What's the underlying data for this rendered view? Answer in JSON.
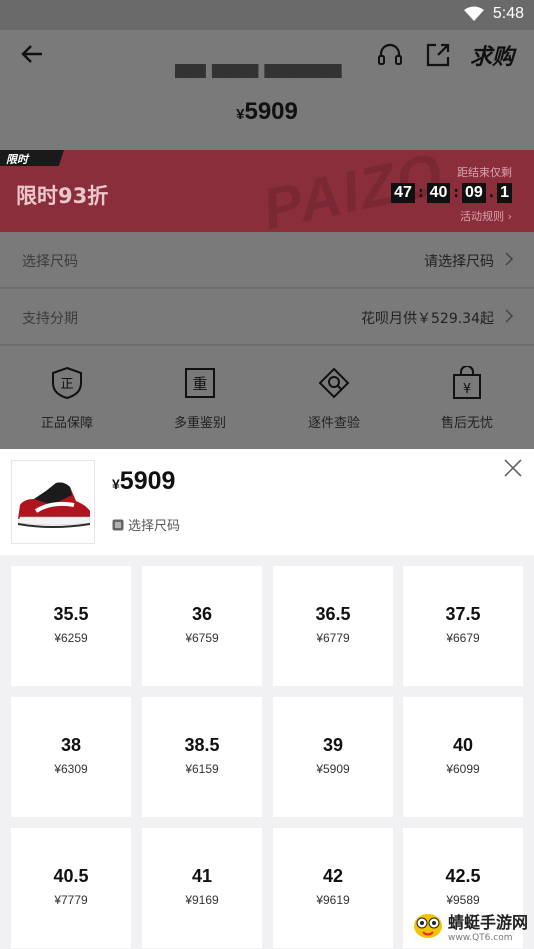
{
  "status_bar": {
    "time": "5:48"
  },
  "header": {
    "request_label": "求购"
  },
  "product": {
    "price_symbol": "¥",
    "price": "5909"
  },
  "promo": {
    "tag": "限时",
    "title": "限时93折",
    "countdown_label": "距结束仅剩",
    "countdown": [
      "47",
      "40",
      "09",
      "1"
    ],
    "rules": "活动规则",
    "watermark": "PAIZO"
  },
  "rows": [
    {
      "label": "选择尺码",
      "value": "请选择尺码"
    },
    {
      "label": "支持分期",
      "value": "花呗月供￥529.34起"
    }
  ],
  "assurances": [
    {
      "label": "正品保障",
      "icon": "genuine-shield-icon"
    },
    {
      "label": "多重鉴别",
      "icon": "multi-check-icon"
    },
    {
      "label": "逐件查验",
      "icon": "inspect-icon"
    },
    {
      "label": "售后无忧",
      "icon": "after-sale-bag-icon"
    }
  ],
  "sheet": {
    "price_symbol": "¥",
    "price": "5909",
    "select_label": "选择尺码",
    "sizes": [
      {
        "size": "35.5",
        "price": "¥6259"
      },
      {
        "size": "36",
        "price": "¥6759"
      },
      {
        "size": "36.5",
        "price": "¥6779"
      },
      {
        "size": "37.5",
        "price": "¥6679"
      },
      {
        "size": "38",
        "price": "¥6309"
      },
      {
        "size": "38.5",
        "price": "¥6159"
      },
      {
        "size": "39",
        "price": "¥5909"
      },
      {
        "size": "40",
        "price": "¥6099"
      },
      {
        "size": "40.5",
        "price": "¥7779"
      },
      {
        "size": "41",
        "price": "¥9169"
      },
      {
        "size": "42",
        "price": "¥9619"
      },
      {
        "size": "42.5",
        "price": "¥9589"
      }
    ]
  },
  "watermark": {
    "name": "蜻蜓手游网",
    "url": "www.QT6.com"
  },
  "colors": {
    "promo_red": "#e8394f",
    "overlay": "#6f6f6f",
    "sheet_bg": "#f1f1f4"
  }
}
